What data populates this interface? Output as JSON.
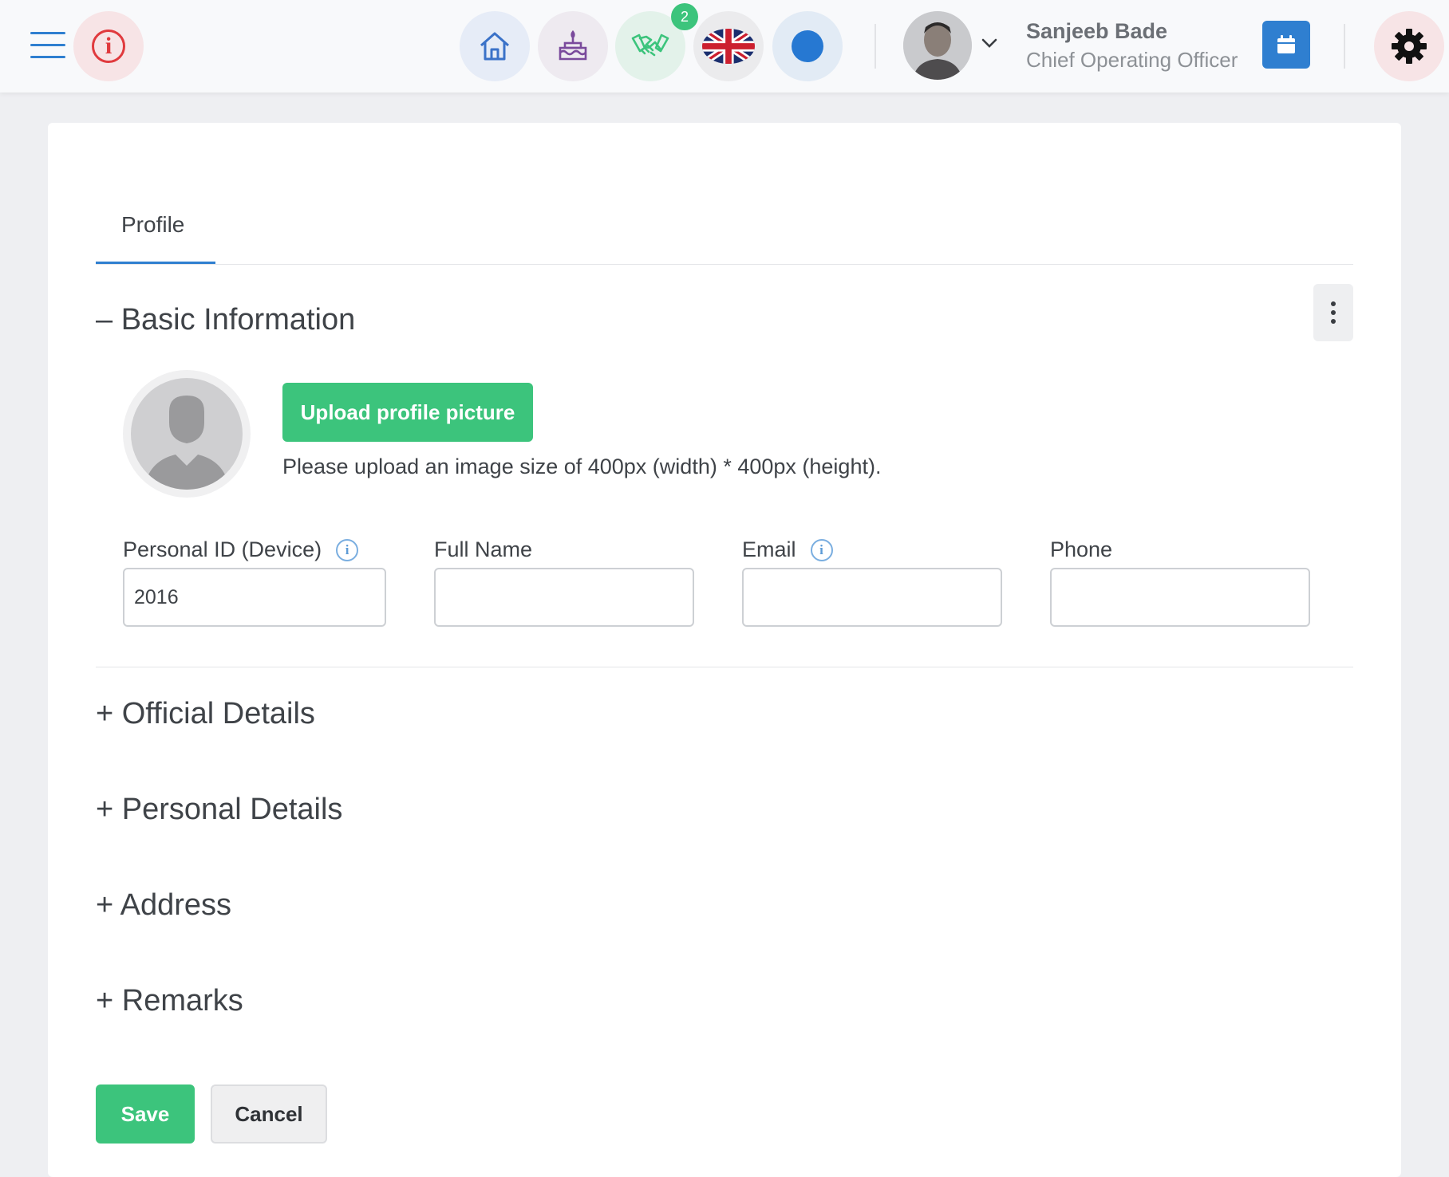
{
  "header": {
    "notification_count": "2",
    "user": {
      "name": "Sanjeeb Bade",
      "role": "Chief Operating Officer"
    },
    "icons": [
      "menu-icon",
      "info-icon",
      "home-icon",
      "birthday-cake-icon",
      "handshake-icon",
      "uk-flag-icon",
      "status-dot-icon",
      "calendar-icon",
      "gear-icon"
    ],
    "colors": {
      "accent": "#2f7fd0",
      "success": "#3cc47c",
      "danger": "#e03a3e"
    }
  },
  "tabs": [
    {
      "label": "Profile",
      "active": true
    }
  ],
  "basic_info": {
    "title": "– Basic Information",
    "upload_label": "Upload profile picture",
    "upload_hint": "Please upload an image size of 400px (width) * 400px (height).",
    "fields": {
      "personal_id": {
        "label": "Personal ID (Device)",
        "value": "2016"
      },
      "full_name": {
        "label": "Full Name",
        "value": ""
      },
      "email": {
        "label": "Email",
        "value": ""
      },
      "phone": {
        "label": "Phone",
        "value": ""
      }
    }
  },
  "sections": {
    "official": "+ Official Details",
    "personal": "+ Personal Details",
    "address": "+ Address",
    "remarks": "+ Remarks"
  },
  "actions": {
    "save": "Save",
    "cancel": "Cancel"
  }
}
